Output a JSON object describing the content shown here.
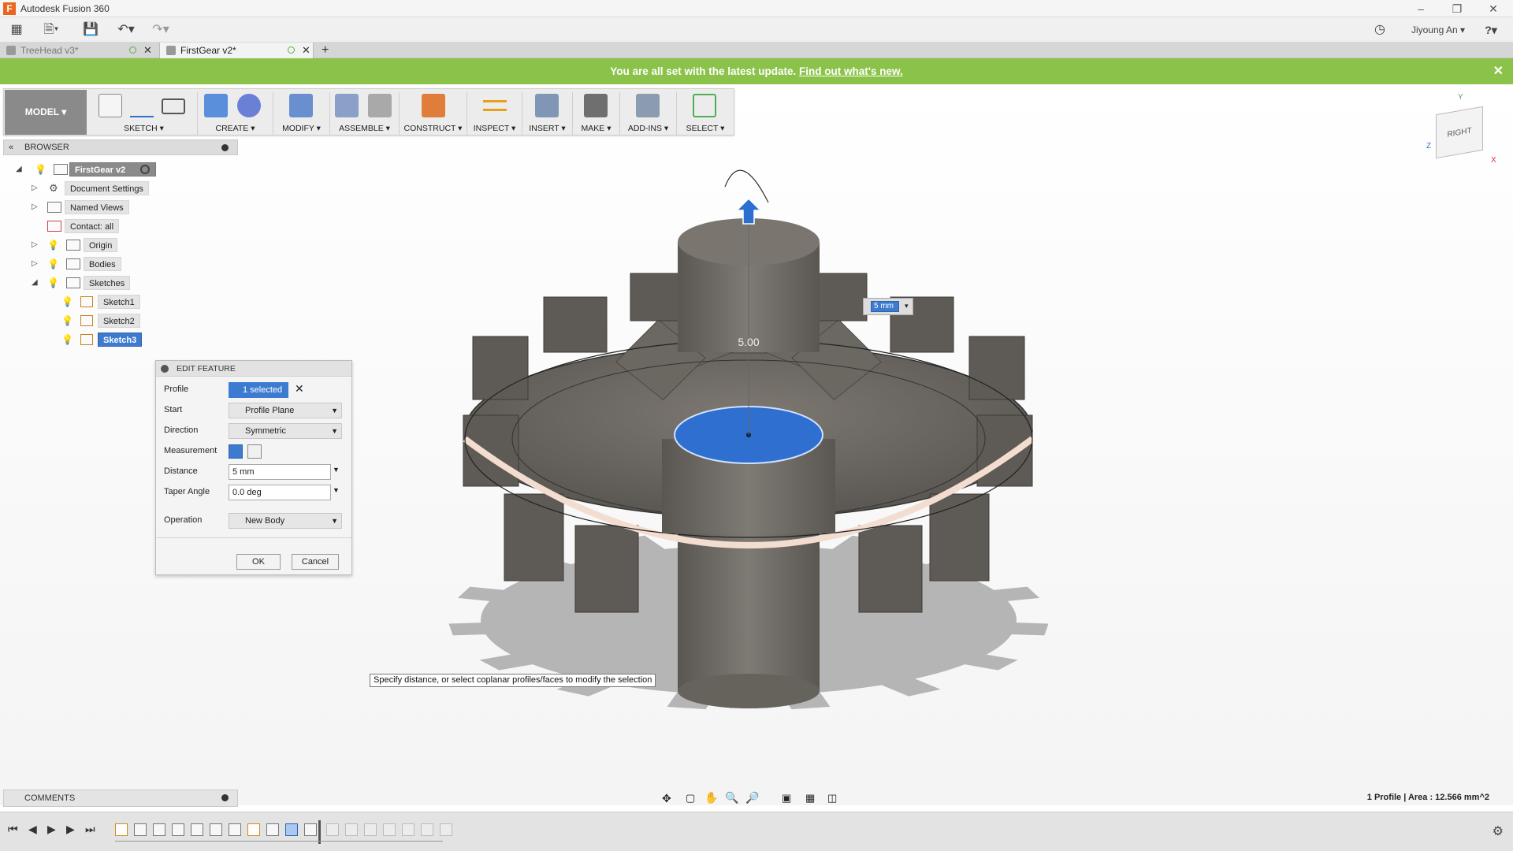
{
  "app": {
    "title": "Autodesk Fusion 360",
    "user": "Jiyoung An",
    "help": "?"
  },
  "tabs": [
    {
      "label": "TreeHead v3*"
    },
    {
      "label": "FirstGear v2*"
    }
  ],
  "banner": {
    "text": "You are all set with the latest update.",
    "link": "Find out what's new."
  },
  "toolbar": {
    "workspace": "MODEL",
    "groups": [
      "SKETCH",
      "CREATE",
      "MODIFY",
      "ASSEMBLE",
      "CONSTRUCT",
      "INSPECT",
      "INSERT",
      "MAKE",
      "ADD-INS",
      "SELECT"
    ]
  },
  "browser": {
    "title": "BROWSER",
    "root": "FirstGear v2",
    "items": [
      {
        "label": "Document Settings"
      },
      {
        "label": "Named Views"
      },
      {
        "label": "Contact: all"
      },
      {
        "label": "Origin"
      },
      {
        "label": "Bodies"
      },
      {
        "label": "Sketches"
      }
    ],
    "sketches": [
      {
        "label": "Sketch1"
      },
      {
        "label": "Sketch2"
      },
      {
        "label": "Sketch3"
      }
    ]
  },
  "dialog": {
    "title": "EDIT FEATURE",
    "profile_label": "Profile",
    "profile_value": "1 selected",
    "start_label": "Start",
    "start_value": "Profile Plane",
    "direction_label": "Direction",
    "direction_value": "Symmetric",
    "measurement_label": "Measurement",
    "distance_label": "Distance",
    "distance_value": "5 mm",
    "taper_label": "Taper Angle",
    "taper_value": "0.0 deg",
    "operation_label": "Operation",
    "operation_value": "New Body",
    "ok_label": "OK",
    "cancel_label": "Cancel"
  },
  "viewport": {
    "dimension_text": "5.00",
    "dimension_input": "5 mm",
    "tooltip": "Specify distance, or select coplanar profiles/faces to modify the selection",
    "viewcube_face": "RIGHT",
    "axis_x": "X",
    "axis_y": "Y",
    "axis_z": "Z"
  },
  "comments": {
    "title": "COMMENTS"
  },
  "status": {
    "text": "1 Profile | Area : 12.566 mm^2"
  },
  "colors": {
    "banner": "#8bc34a",
    "selection": "#3c7bd0",
    "gear": "#6e6a64"
  }
}
